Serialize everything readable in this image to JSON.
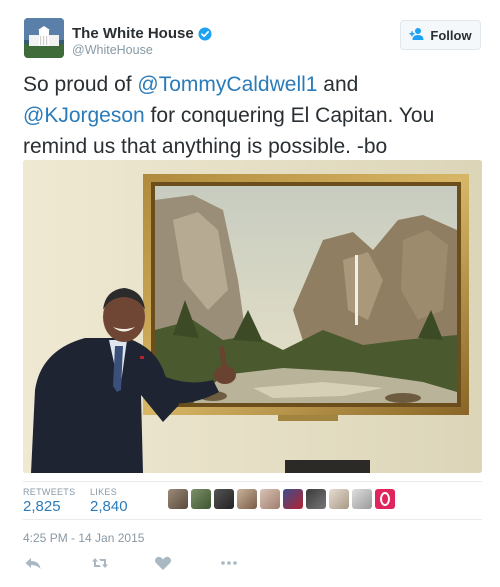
{
  "author": {
    "name": "The White House",
    "handle": "@WhiteHouse",
    "verified": true
  },
  "follow_button": {
    "label": "Follow"
  },
  "tweet": {
    "text_prefix": "So proud of ",
    "mention_1": "@TommyCaldwell1",
    "text_mid": " and ",
    "mention_2": "@KJorgeson",
    "text_suffix": " for conquering El Capitan. You remind us that anything is possible. -bo"
  },
  "stats": {
    "retweets_label": "RETWEETS",
    "retweets_value": "2,825",
    "likes_label": "LIKES",
    "likes_value": "2,840"
  },
  "timestamp": "4:25 PM - 14 Jan 2015",
  "colors": {
    "link": "#2b7bb9",
    "muted": "#8899a6",
    "text": "#292f33",
    "like_accent": "#e0245e"
  },
  "icons": {
    "verified": "verified-badge-icon",
    "follow": "add-user-icon",
    "reply": "reply-icon",
    "retweet": "retweet-icon",
    "like": "heart-icon",
    "more": "more-icon"
  }
}
